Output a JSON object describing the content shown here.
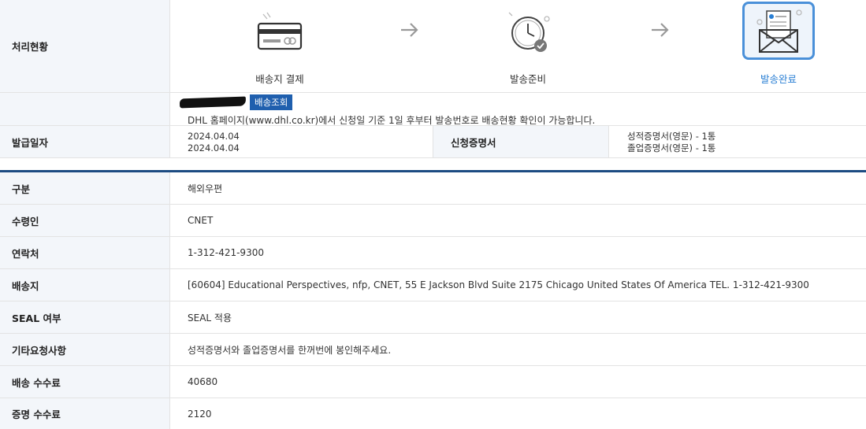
{
  "status": {
    "header": "처리현황",
    "steps": [
      {
        "label": "배송지 결제",
        "icon": "credit-card-icon",
        "active": false
      },
      {
        "label": "발송준비",
        "icon": "clock-check-icon",
        "active": false
      },
      {
        "label": "발송완료",
        "icon": "envelope-document-icon",
        "active": true
      }
    ],
    "active_color": "#2a7fd4"
  },
  "tracking": {
    "button_label": "배송조회",
    "note": "DHL 홈페이지(www.dhl.co.kr)에서 신청일 기준 1일 후부터 발송번호로 배송현황 확인이 가능합니다."
  },
  "issue": {
    "header": "발급일자",
    "dates": [
      "2024.04.04",
      "2024.04.04"
    ],
    "cert_header": "신청증명서",
    "certs": [
      "성적증명서(영문) - 1통",
      "졸업증명서(영문) - 1통"
    ]
  },
  "details": [
    {
      "label": "구분",
      "value": "해외우편"
    },
    {
      "label": "수령인",
      "value": "CNET"
    },
    {
      "label": "연락처",
      "value": "1-312-421-9300"
    },
    {
      "label": "배송지",
      "value": "[60604] Educational Perspectives, nfp, CNET, 55 E Jackson Blvd Suite 2175 Chicago United States Of America TEL. 1-312-421-9300"
    },
    {
      "label": "SEAL 여부",
      "value": "SEAL 적용"
    },
    {
      "label": "기타요청사항",
      "value": "성적증명서와 졸업증명서를 한꺼번에 봉인해주세요."
    },
    {
      "label": "배송 수수료",
      "value": "40680"
    },
    {
      "label": "증명 수수료",
      "value": "2120"
    }
  ],
  "colors": {
    "header_bg": "#f3f6fa",
    "button_bg": "#1f5fae",
    "divider": "#1c4b82"
  }
}
